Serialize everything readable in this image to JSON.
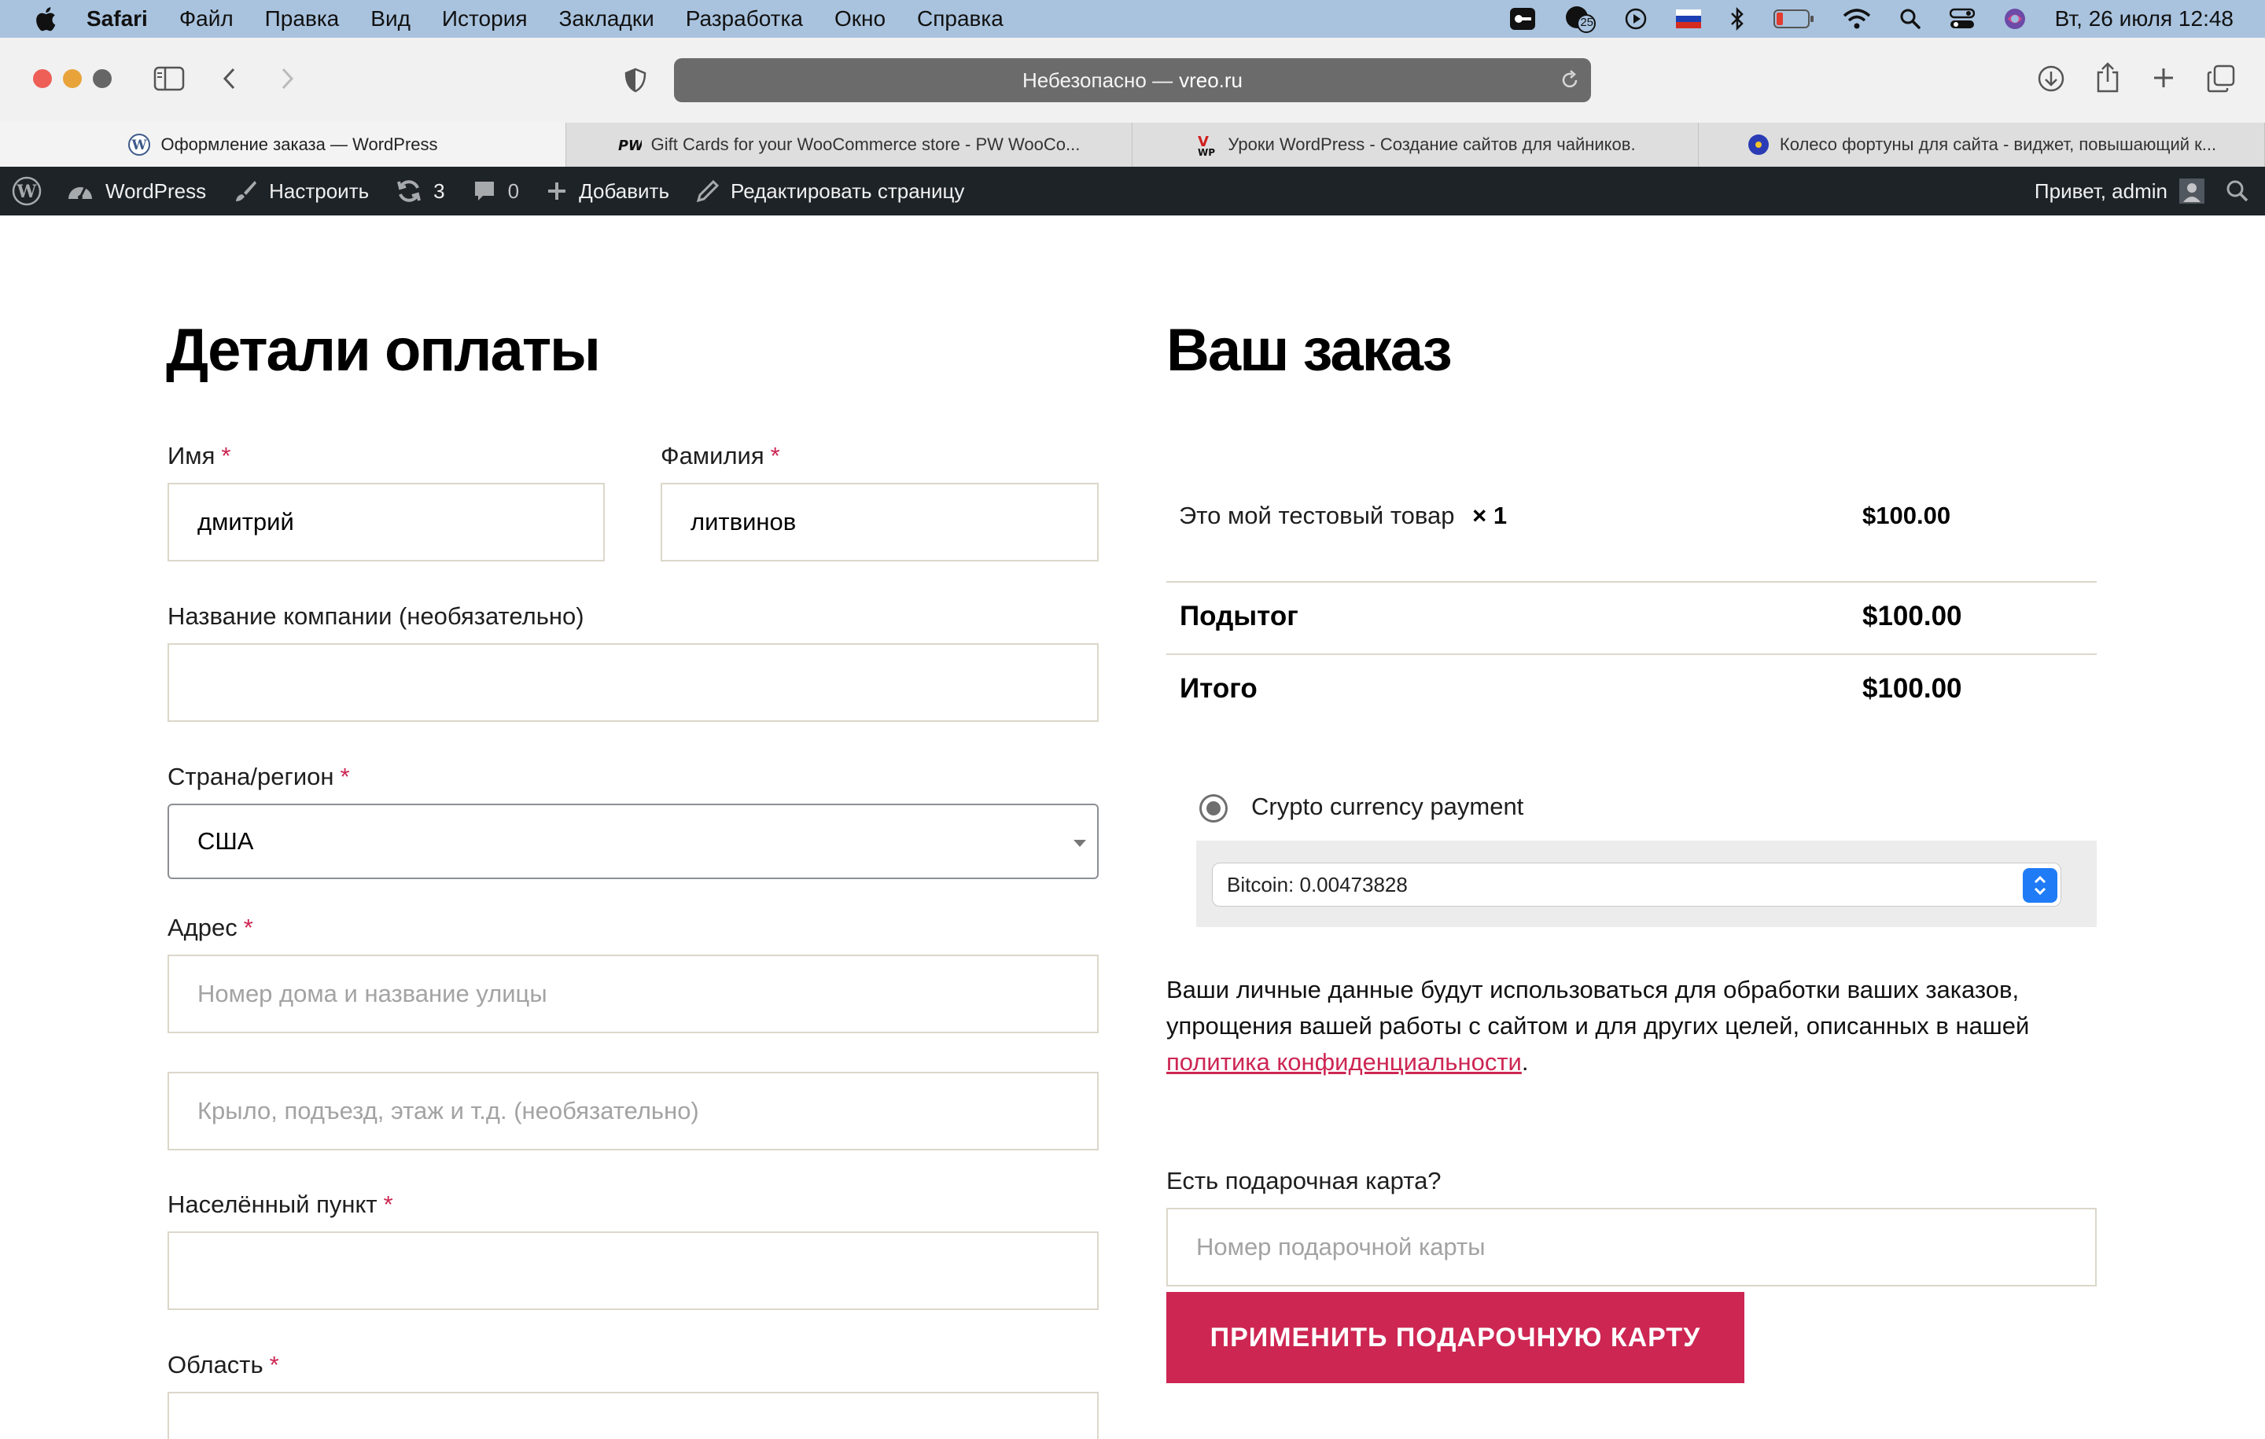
{
  "menubar": {
    "app": "Safari",
    "items": [
      "Файл",
      "Правка",
      "Вид",
      "История",
      "Закладки",
      "Разработка",
      "Окно",
      "Справка"
    ],
    "status_badge": "25",
    "clock": "Вт, 26 июля  12:48"
  },
  "toolbar": {
    "url_prefix": "Небезопасно —",
    "url_domain": "vreo.ru"
  },
  "tabs": [
    {
      "title": "Оформление заказа — WordPress",
      "icon": "wordpress-icon"
    },
    {
      "title": "Gift Cards for your WooCommerce store - PW WooCo...",
      "icon": "pw-icon"
    },
    {
      "title": "Уроки WordPress - Создание сайтов для чайников.",
      "icon": "vwp-icon"
    },
    {
      "title": "Колесо фортуны для сайта - виджет, повышающий к...",
      "icon": "globe-icon"
    }
  ],
  "adminbar": {
    "site": "WordPress",
    "customize": "Настроить",
    "updates": "3",
    "comments": "0",
    "add_new": "Добавить",
    "edit_page": "Редактировать страницу",
    "greeting": "Привет, admin"
  },
  "billing": {
    "title": "Детали оплаты",
    "first_name_label": "Имя",
    "first_name_value": "дмитрий",
    "last_name_label": "Фамилия",
    "last_name_value": "литвинов",
    "company_label": "Название компании (необязательно)",
    "company_value": "",
    "country_label": "Страна/регион",
    "country_value": "США",
    "address_label": "Адрес",
    "address1_placeholder": "Номер дома и название улицы",
    "address2_placeholder": "Крыло, подъезд, этаж и т.д. (необязательно)",
    "city_label": "Населённый пункт",
    "city_value": "",
    "region_label": "Область",
    "required_mark": "*"
  },
  "order": {
    "title": "Ваш заказ",
    "product_name": "Это мой тестовый товар",
    "product_qty": "× 1",
    "product_price": "$100.00",
    "subtotal_label": "Подытог",
    "subtotal_value": "$100.00",
    "total_label": "Итого",
    "total_value": "$100.00",
    "payment_method": "Crypto currency payment",
    "crypto_option": "Bitcoin: 0.00473828",
    "privacy_text": "Ваши личные данные будут использоваться для обработки ваших заказов, упрощения вашей работы с сайтом и для других целей, описанных в нашей",
    "privacy_link": "политика конфиденциальности",
    "privacy_end": ".",
    "gift_label": "Есть подарочная карта?",
    "gift_placeholder": "Номер подарочной карты",
    "gift_button": "ПРИМЕНИТЬ ПОДАРОЧНУЮ КАРТУ"
  },
  "colors": {
    "accent": "#cd2653",
    "adminbar": "#1d2327",
    "menubar": "#a9c3de",
    "input_border": "#dcd7ca"
  }
}
